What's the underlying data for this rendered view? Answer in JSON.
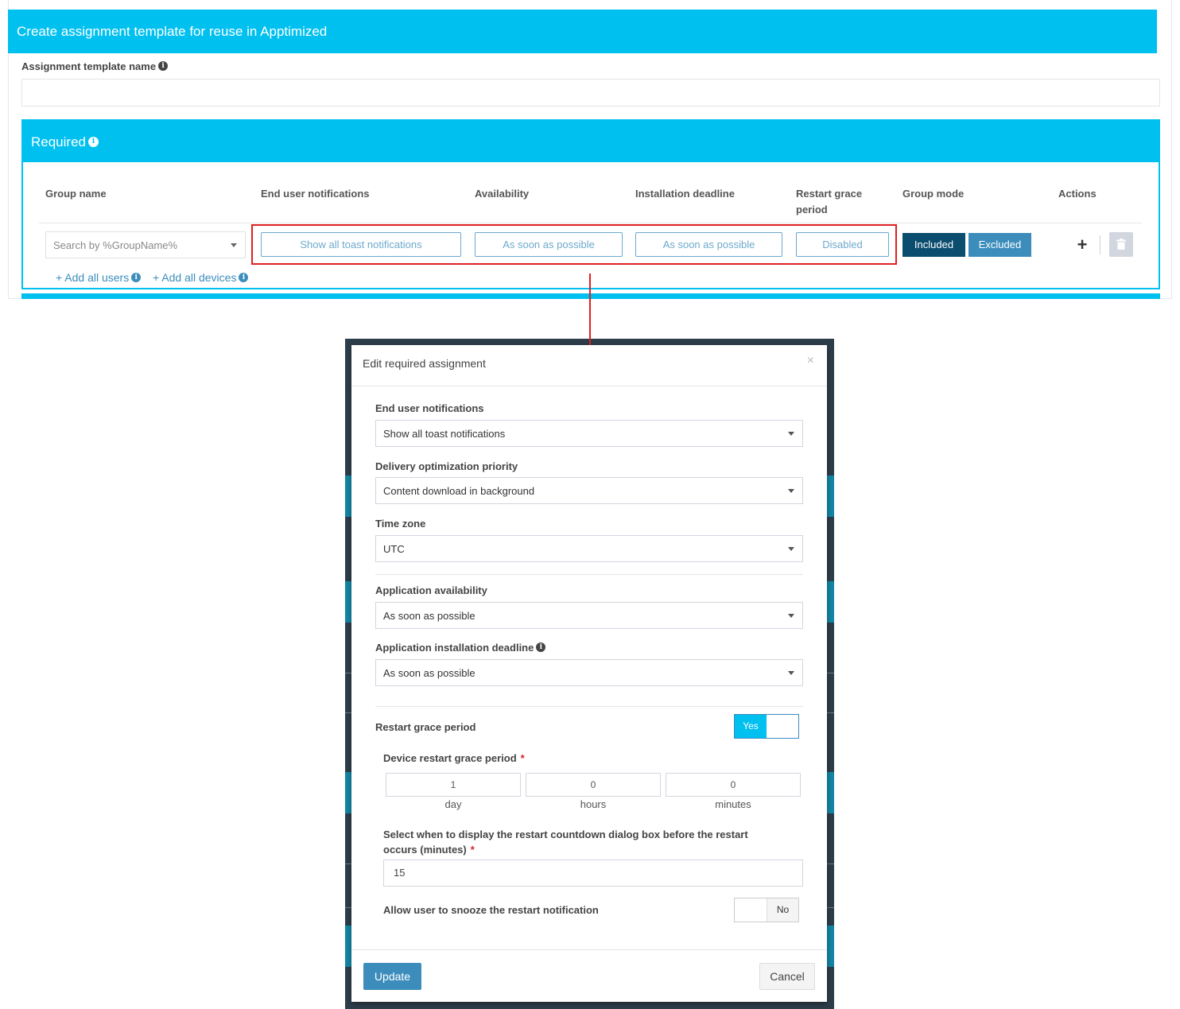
{
  "page": {
    "title": "Create assignment template for reuse in Apptimized",
    "template_name_label": "Assignment template name",
    "template_name_value": ""
  },
  "required": {
    "title": "Required",
    "columns": [
      "Group name",
      "End user notifications",
      "Availability",
      "Installation deadline",
      "Restart grace period",
      "Group mode",
      "Actions"
    ],
    "row": {
      "group_placeholder": "Search by %GroupName%",
      "notifications": "Show all toast notifications",
      "availability": "As soon as possible",
      "deadline": "As soon as possible",
      "restart_grace": "Disabled",
      "mode_included": "Included",
      "mode_excluded": "Excluded",
      "add_symbol": "+"
    },
    "links": {
      "add_all_users": "+ Add all users",
      "add_all_devices": "+ Add all devices"
    }
  },
  "modal": {
    "title": "Edit required assignment",
    "close_symbol": "×",
    "notifications_label": "End user notifications",
    "notifications_value": "Show all toast notifications",
    "delivery_label": "Delivery optimization priority",
    "delivery_value": "Content download in background",
    "timezone_label": "Time zone",
    "timezone_value": "UTC",
    "availability_label": "Application availability",
    "availability_value": "As soon as possible",
    "deadline_label": "Application installation deadline",
    "deadline_value": "As soon as possible",
    "restart_grace_label": "Restart grace period",
    "restart_grace_toggle": "Yes",
    "device_restart_label": "Device restart grace period",
    "required_mark": "*",
    "grace_day": "1",
    "grace_hours": "0",
    "grace_minutes": "0",
    "unit_day": "day",
    "unit_hours": "hours",
    "unit_minutes": "minutes",
    "countdown_label_line1": "Select when to display the restart countdown dialog box before the restart",
    "countdown_label_line2": "occurs (minutes)",
    "countdown_value": "15",
    "snooze_label": "Allow user to snooze the restart notification",
    "snooze_toggle": "No",
    "update_label": "Update",
    "cancel_label": "Cancel"
  },
  "colors": {
    "header_cyan": "#00c0ef",
    "primary_blue": "#3c8dbc",
    "included_dark": "#0b4d6e",
    "highlight_red": "#e02020"
  }
}
